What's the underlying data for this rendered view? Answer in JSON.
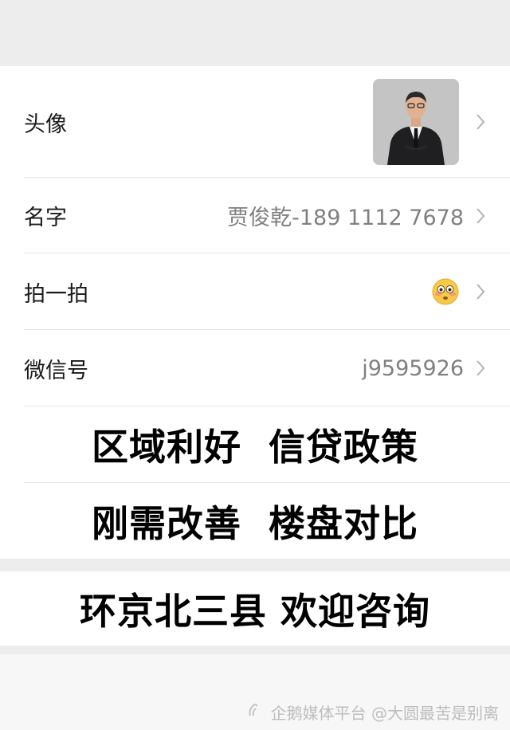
{
  "profile": {
    "avatar_label": "头像",
    "name_label": "名字",
    "name_value": "贾俊乾-189 1112 7678",
    "pat_label": "拍一拍",
    "pat_icon": "flushed-face-emoji-icon",
    "wechat_label": "微信号",
    "wechat_value": "j9595926",
    "chevron_icon": "chevron-right-icon"
  },
  "banners": {
    "line1": "区域利好  信贷政策",
    "line2": "刚需改善  楼盘对比",
    "line3": "环京北三县 欢迎咨询"
  },
  "watermark": {
    "text": "企鹅媒体平台 @大圆最苦是别离",
    "icon": "penguin-media-icon"
  }
}
